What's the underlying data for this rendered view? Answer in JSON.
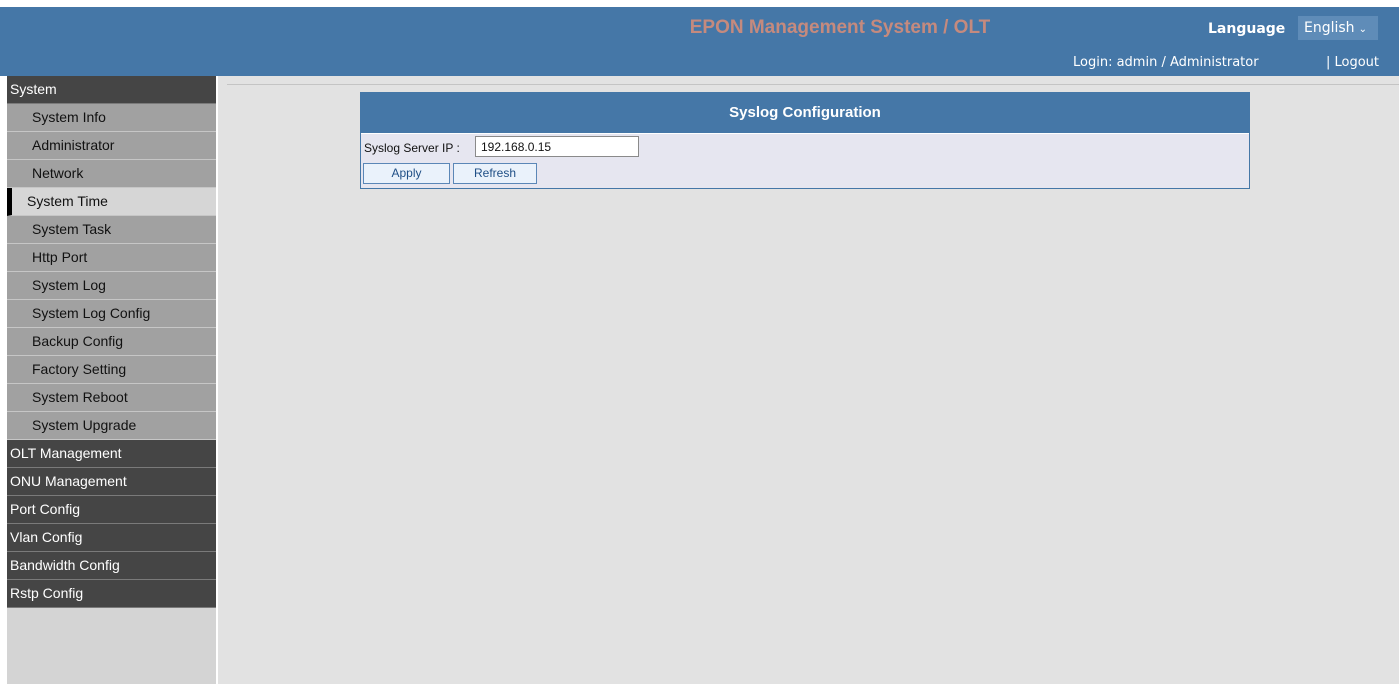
{
  "header": {
    "title": "EPON Management System / OLT",
    "language_label": "Language",
    "language_value": "English",
    "login_text": "Login: admin / Administrator",
    "logout_label": "| Logout"
  },
  "sidebar": {
    "system": {
      "label": "System",
      "items": [
        {
          "label": "System Info"
        },
        {
          "label": "Administrator"
        },
        {
          "label": "Network"
        },
        {
          "label": "System Time"
        },
        {
          "label": "System Task"
        },
        {
          "label": "Http Port"
        },
        {
          "label": "System Log"
        },
        {
          "label": "System Log Config"
        },
        {
          "label": "Backup Config"
        },
        {
          "label": "Factory Setting"
        },
        {
          "label": "System Reboot"
        },
        {
          "label": "System Upgrade"
        }
      ],
      "active": "System Time"
    },
    "categories": [
      {
        "label": "OLT Management"
      },
      {
        "label": "ONU Management"
      },
      {
        "label": "Port Config"
      },
      {
        "label": "Vlan Config"
      },
      {
        "label": "Bandwidth Config"
      },
      {
        "label": "Rstp Config"
      }
    ]
  },
  "main": {
    "panel_title": "Syslog Configuration",
    "field_label": "Syslog Server IP :",
    "server_ip": "192.168.0.15",
    "apply_label": "Apply",
    "refresh_label": "Refresh"
  },
  "colors": {
    "header_bg": "#4577a7",
    "title_color": "#c58a7e",
    "category_bg": "#454545",
    "item_bg": "#a1a1a1",
    "active_item_bg": "#d6d6d6",
    "content_bg": "#e2e2e2"
  }
}
